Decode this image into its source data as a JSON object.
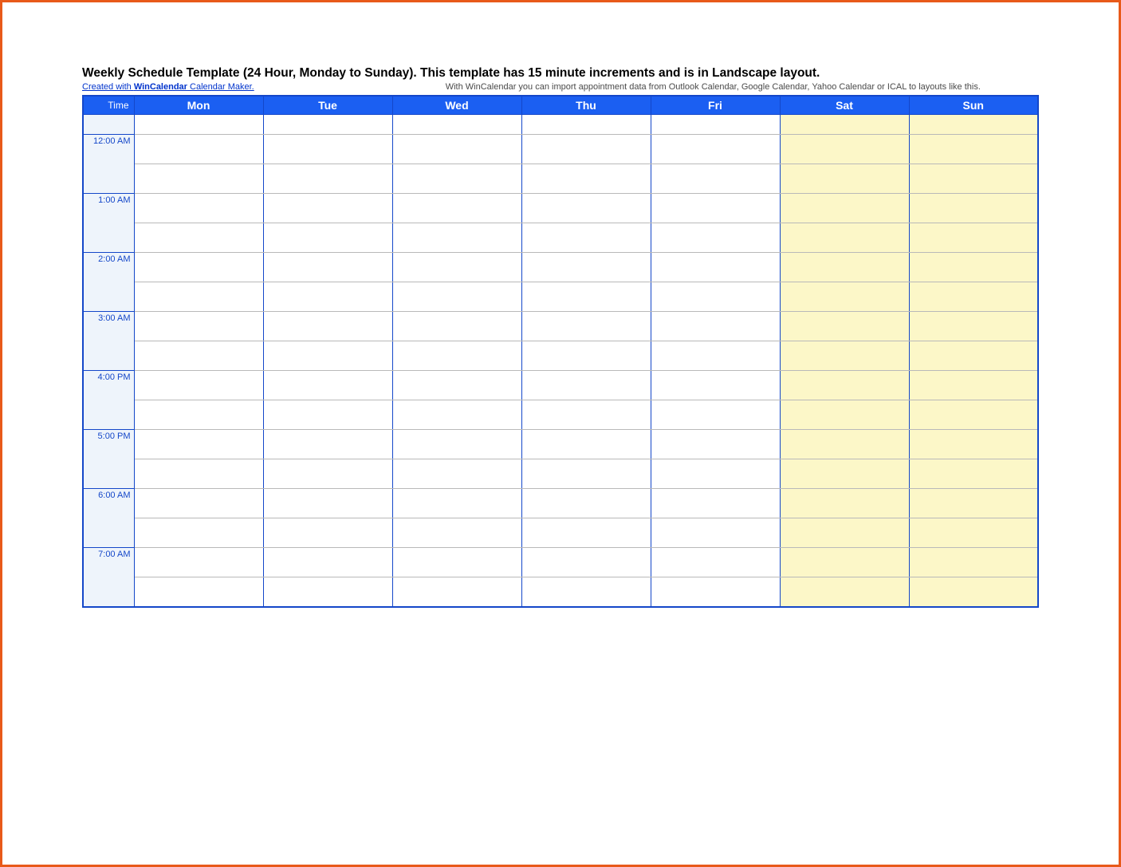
{
  "header": {
    "title": "Weekly Schedule Template (24 Hour, Monday to Sunday).  This template has 15 minute increments and is in Landscape layout.",
    "created_prefix": "Created with ",
    "created_brand": "WinCalendar",
    "created_suffix": " Calendar Maker.",
    "import_note": "With WinCalendar you can import appointment data from Outlook Calendar, Google Calendar, Yahoo Calendar or ICAL to layouts like this."
  },
  "columns": {
    "time": "Time",
    "days": [
      "Mon",
      "Tue",
      "Wed",
      "Thu",
      "Fri",
      "Sat",
      "Sun"
    ]
  },
  "weekend_indexes": [
    5,
    6
  ],
  "time_slots": [
    "12:00 AM",
    "1:00 AM",
    "2:00 AM",
    "3:00 AM",
    "4:00 PM",
    "5:00 PM",
    "6:00 AM",
    "7:00 AM"
  ],
  "rows_per_hour": 2,
  "leading_blank_row": true
}
